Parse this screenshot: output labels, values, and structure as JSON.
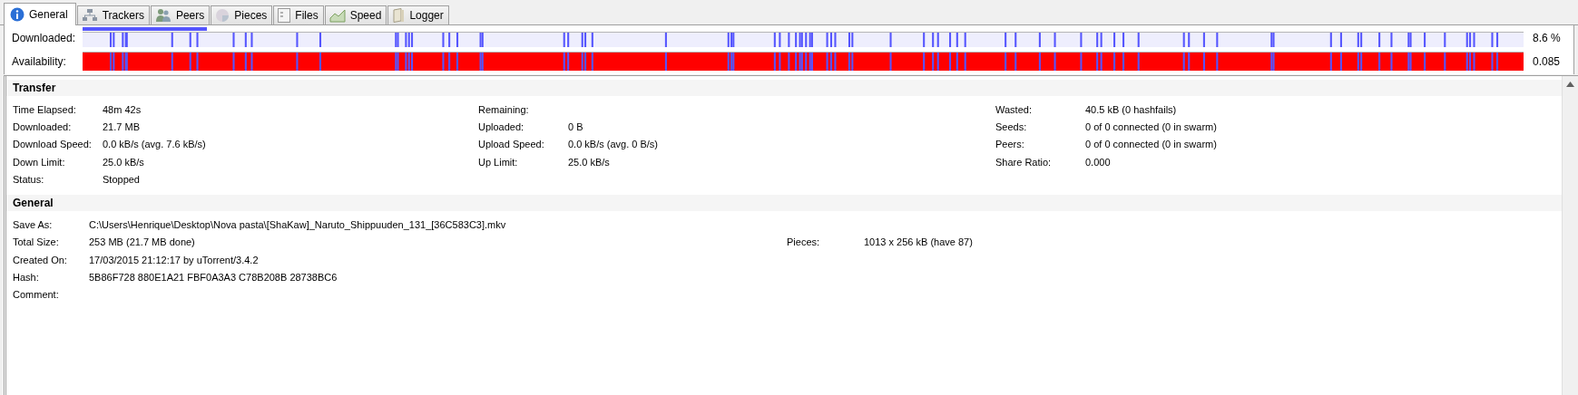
{
  "tabs": [
    {
      "label": "General",
      "kind": "info",
      "selected": true
    },
    {
      "label": "Trackers",
      "kind": "network",
      "selected": false
    },
    {
      "label": "Peers",
      "kind": "people",
      "selected": false
    },
    {
      "label": "Pieces",
      "kind": "pie",
      "selected": false
    },
    {
      "label": "Files",
      "kind": "file",
      "selected": false
    },
    {
      "label": "Speed",
      "kind": "graph",
      "selected": false
    },
    {
      "label": "Logger",
      "kind": "book",
      "selected": false
    }
  ],
  "bars": [
    {
      "label": "Downloaded:",
      "kind": "pieces",
      "level": 0.086,
      "reading": "8.6 %"
    },
    {
      "label": "Availability:",
      "kind": "availability",
      "reading": "0.085"
    }
  ],
  "sections": [
    {
      "title": "Transfer",
      "kind": "three-column",
      "columns": [
        [
          {
            "label": "Time Elapsed:",
            "value": "48m 42s"
          },
          {
            "label": "Downloaded:",
            "value": "21.7 MB"
          },
          {
            "label": "Download Speed:",
            "value": "0.0 kB/s (avg. 7.6 kB/s)"
          },
          {
            "label": "Down Limit:",
            "value": "25.0 kB/s"
          },
          {
            "label": "Status:",
            "value": "Stopped"
          }
        ],
        [
          {
            "label": "Remaining:"
          },
          {
            "label": "Uploaded:",
            "value": "0 B"
          },
          {
            "label": "Upload Speed:",
            "value": "0.0 kB/s (avg. 0 B/s)"
          },
          {
            "label": "Up Limit:",
            "value": "25.0 kB/s"
          }
        ],
        [
          {
            "label": "Wasted:",
            "value": "40.5 kB (0 hashfails)"
          },
          {
            "label": "Seeds:",
            "value": "0 of 0 connected (0 in swarm)"
          },
          {
            "label": "Peers:",
            "value": "0 of 0 connected (0 in swarm)"
          },
          {
            "label": "Share Ratio:",
            "value": "0.000"
          }
        ]
      ]
    },
    {
      "title": "General",
      "kind": "list",
      "rows": [
        {
          "label": "Save As:",
          "value": "C:\\Users\\Henrique\\Desktop\\Nova pasta\\[ShaKaw]_Naruto_Shippuuden_131_[36C583C3].mkv"
        },
        {
          "label": "Total Size:",
          "value": "253 MB (21.7 MB done)",
          "side_label": "Pieces:",
          "side_value": "1013 x 256 kB (have 87)"
        },
        {
          "label": "Created On:",
          "value": "17/03/2015 21:12:17 by uTorrent/3.4.2"
        },
        {
          "label": "Hash:",
          "value": "5B86F728 880E1A21 FBF0A3A3 C78B208B 28738BC6"
        },
        {
          "label": "Comment:"
        }
      ]
    }
  ]
}
